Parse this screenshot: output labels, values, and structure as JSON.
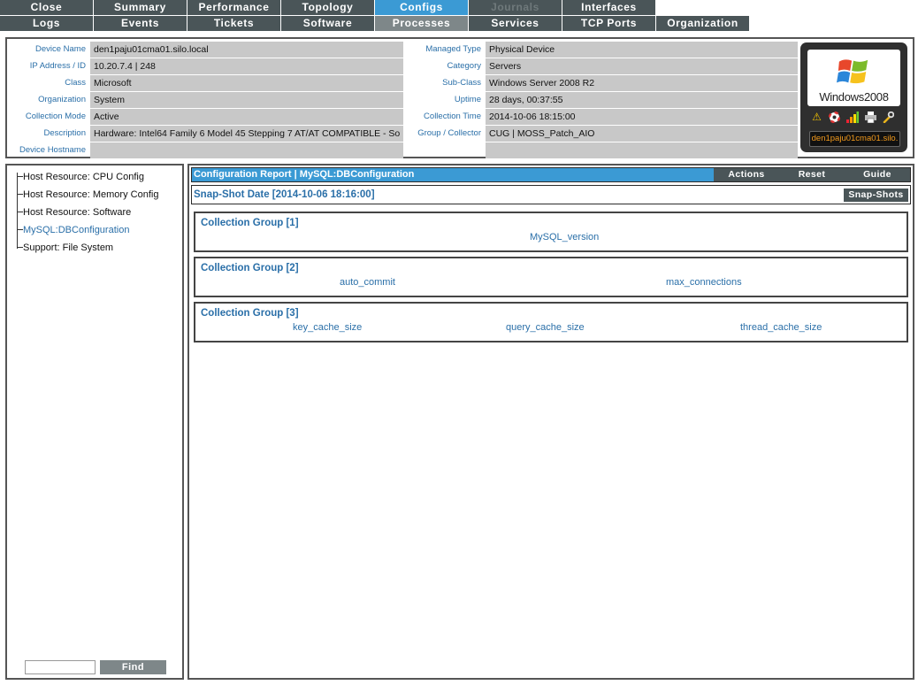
{
  "tabs": {
    "row1": [
      {
        "label": "Close",
        "state": "normal"
      },
      {
        "label": "Summary",
        "state": "normal"
      },
      {
        "label": "Performance",
        "state": "normal"
      },
      {
        "label": "Topology",
        "state": "normal"
      },
      {
        "label": "Configs",
        "state": "active"
      },
      {
        "label": "Journals",
        "state": "disabled"
      },
      {
        "label": "Interfaces",
        "state": "normal"
      }
    ],
    "row2": [
      {
        "label": "Logs",
        "state": "normal"
      },
      {
        "label": "Events",
        "state": "normal"
      },
      {
        "label": "Tickets",
        "state": "normal"
      },
      {
        "label": "Software",
        "state": "normal"
      },
      {
        "label": "Processes",
        "state": "grey"
      },
      {
        "label": "Services",
        "state": "normal"
      },
      {
        "label": "TCP Ports",
        "state": "normal"
      },
      {
        "label": "Organization",
        "state": "normal"
      }
    ]
  },
  "device": {
    "left": [
      {
        "label": "Device Name",
        "value": "den1paju01cma01.silo.local"
      },
      {
        "label": "IP Address / ID",
        "value": "10.20.7.4 | 248"
      },
      {
        "label": "Class",
        "value": "Microsoft"
      },
      {
        "label": "Organization",
        "value": "System"
      },
      {
        "label": "Collection Mode",
        "value": "Active"
      },
      {
        "label": "Description",
        "value": "Hardware: Intel64 Family 6 Model 45 Stepping 7 AT/AT COMPATIBLE - So"
      },
      {
        "label": "Device Hostname",
        "value": ""
      }
    ],
    "right": [
      {
        "label": "Managed Type",
        "value": "Physical Device"
      },
      {
        "label": "Category",
        "value": "Servers"
      },
      {
        "label": "Sub-Class",
        "value": "Windows Server 2008 R2"
      },
      {
        "label": "Uptime",
        "value": "28 days, 00:37:55"
      },
      {
        "label": "Collection Time",
        "value": "2014-10-06 18:15:00"
      },
      {
        "label": "Group / Collector",
        "value": "CUG | MOSS_Patch_AIO"
      },
      {
        "label": "",
        "value": ""
      }
    ],
    "os_logo_text": "Windows2008",
    "name_badge": "den1paju01cma01.silo.",
    "status_icons": [
      "warning-icon",
      "lifebuoy-icon",
      "signal-bars-icon",
      "printer-icon",
      "wrench-icon"
    ]
  },
  "tree": {
    "items": [
      {
        "label": "Host Resource: CPU Config",
        "active": false
      },
      {
        "label": "Host Resource: Memory Config",
        "active": false
      },
      {
        "label": "Host Resource: Software",
        "active": false
      },
      {
        "label": "MySQL:DBConfiguration",
        "active": true
      },
      {
        "label": "Support: File System",
        "active": false
      }
    ],
    "find_value": "",
    "find_label": "Find"
  },
  "report": {
    "title": "Configuration Report | MySQL:DBConfiguration",
    "actions_label": "Actions",
    "reset_label": "Reset",
    "guide_label": "Guide",
    "snapshot_date": "Snap-Shot Date [2014-10-06 18:16:00]",
    "snapshots_label": "Snap-Shots",
    "groups": [
      {
        "title": "Collection Group [1]",
        "fields": [
          "MySQL_version"
        ]
      },
      {
        "title": "Collection Group [2]",
        "fields": [
          "auto_commit",
          "max_connections"
        ]
      },
      {
        "title": "Collection Group [3]",
        "fields": [
          "key_cache_size",
          "query_cache_size",
          "thread_cache_size"
        ]
      }
    ]
  },
  "colors": {
    "tab_bg": "#4a5558",
    "tab_active": "#3b9ad4",
    "label_blue": "#2a6fa8",
    "value_bg": "#c8c8c8",
    "badge_text": "#f29a1d"
  }
}
